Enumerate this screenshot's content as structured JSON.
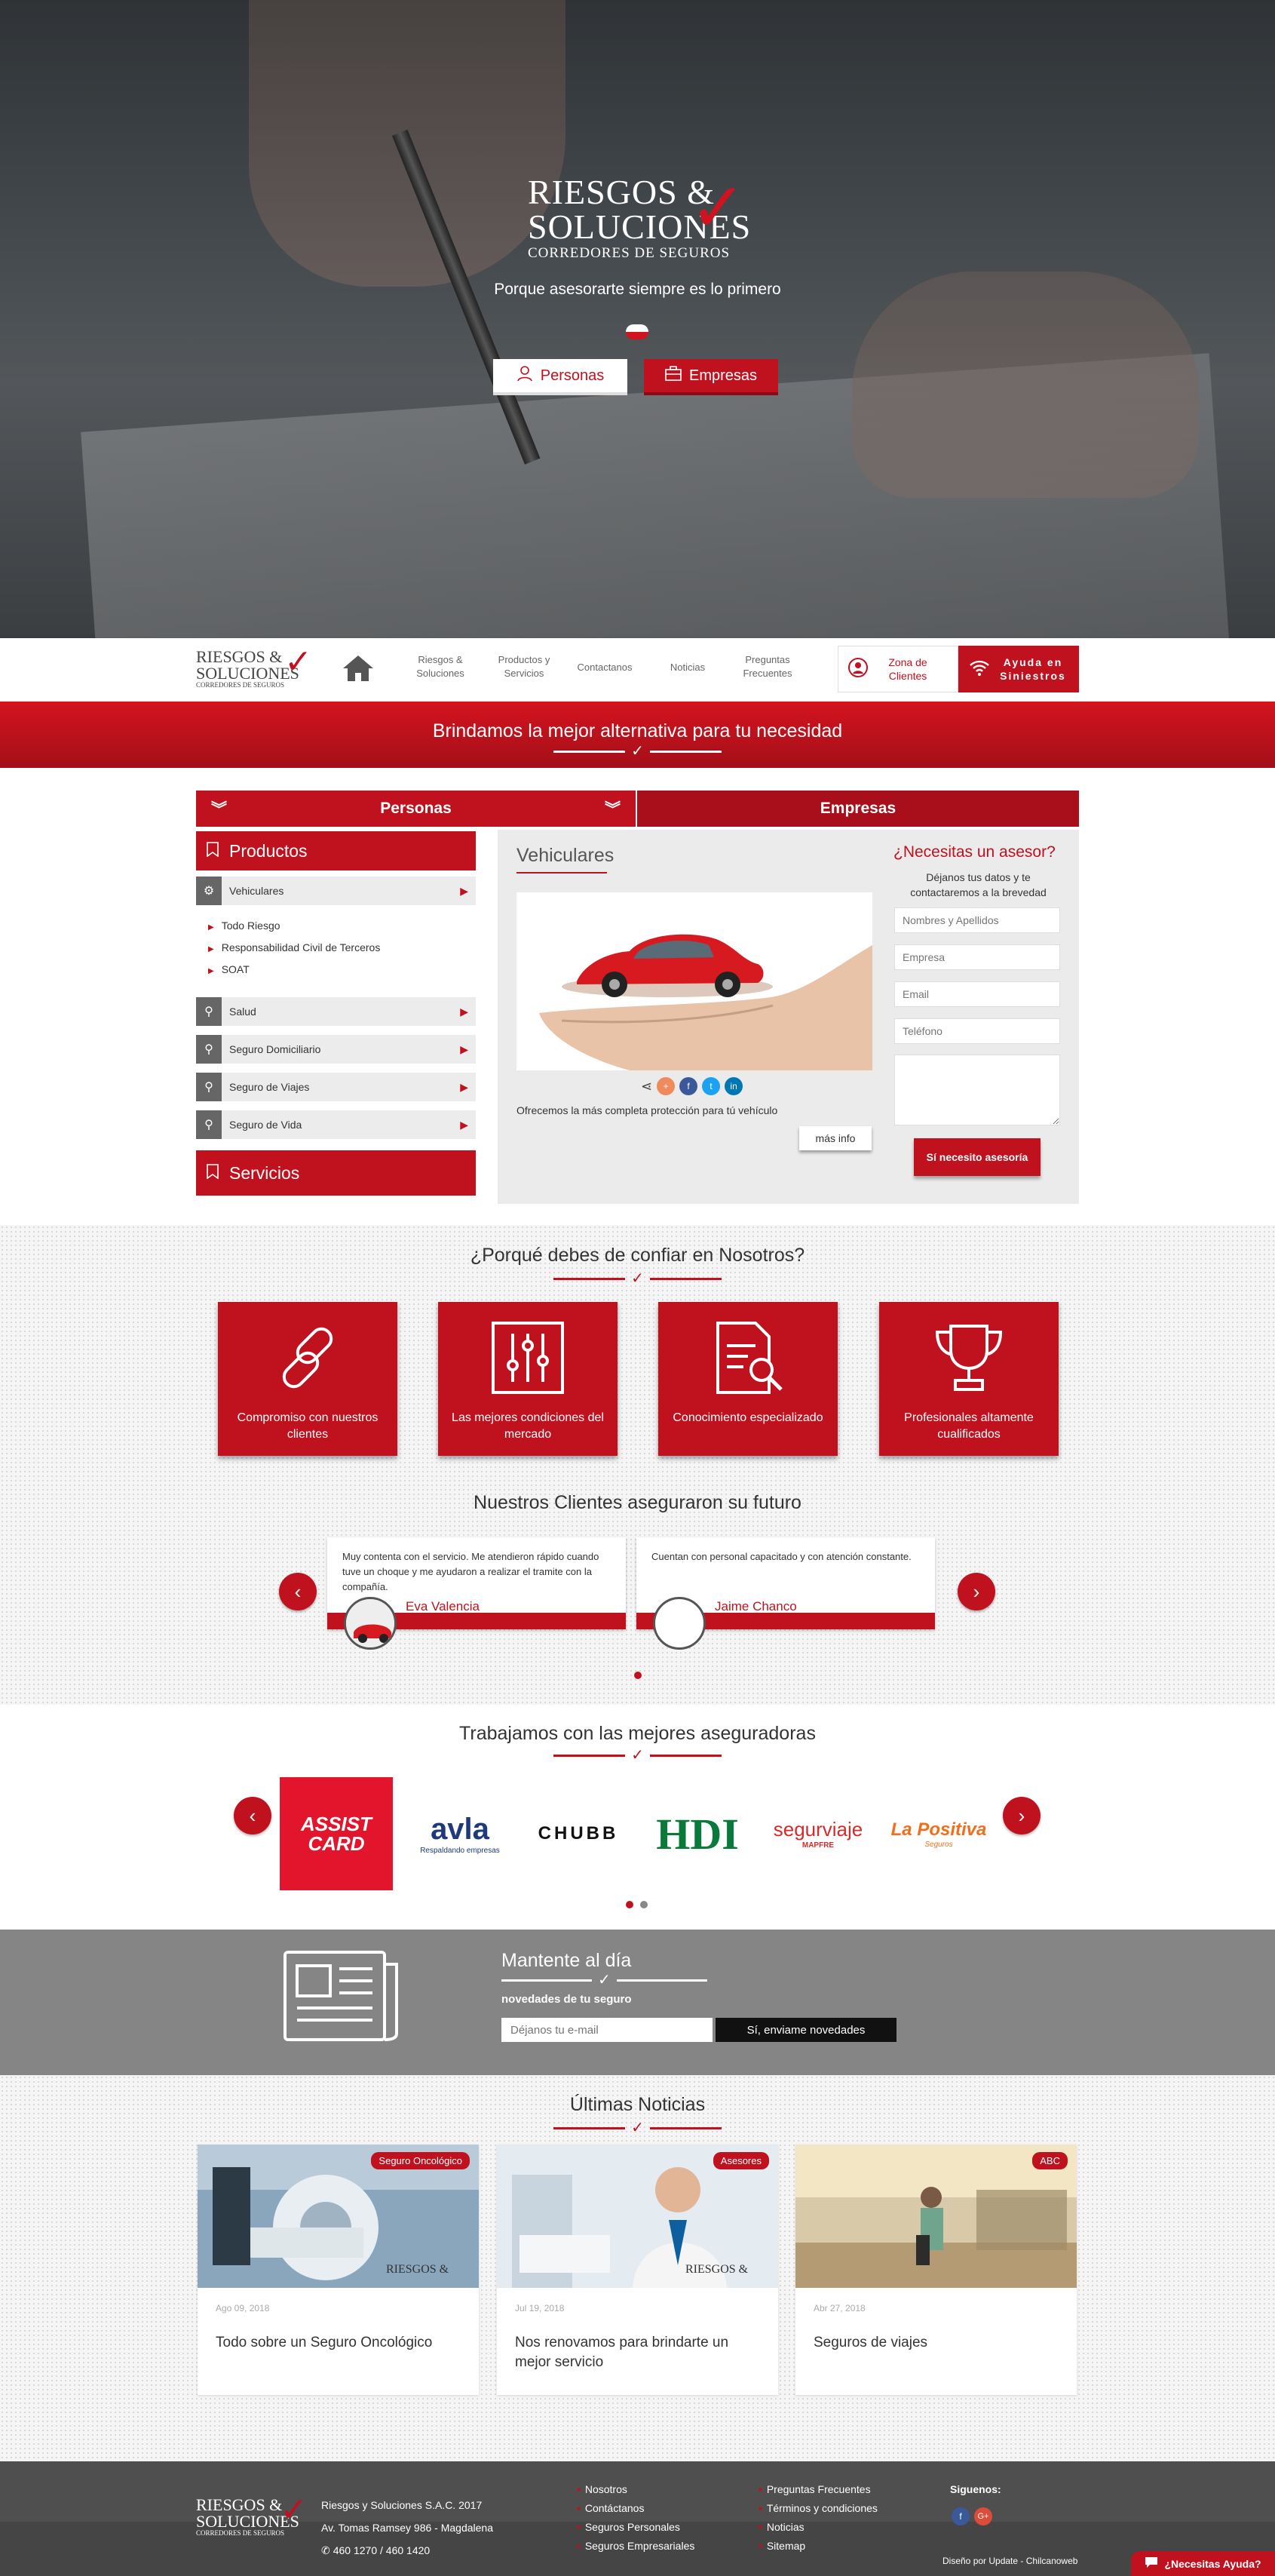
{
  "hero": {
    "logo": {
      "line1": "RIESGOS &",
      "line2": "SOLUCIONES",
      "line3": "CORREDORES DE SEGUROS"
    },
    "tagline": "Porque asesorarte siempre es lo primero",
    "btn_personas": "Personas",
    "btn_empresas": "Empresas"
  },
  "nav": {
    "logo": {
      "line1": "RIESGOS &",
      "line2": "SOLUCIONES",
      "line3": "CORREDORES DE SEGUROS"
    },
    "items": [
      {
        "label": "Riesgos & Soluciones"
      },
      {
        "label": "Productos y Servicios"
      },
      {
        "label": "Contactanos"
      },
      {
        "label": "Noticias"
      },
      {
        "label": "Preguntas Frecuentes"
      }
    ],
    "zona": "Zona de Clientes",
    "ayuda": "Ayuda en Siniestros"
  },
  "banner": {
    "text": "Brindamos la mejor alternativa para tu necesidad"
  },
  "tabs": {
    "personas": "Personas",
    "empresas": "Empresas"
  },
  "sidebar": {
    "productos": "Productos",
    "servicios": "Servicios",
    "items": [
      {
        "label": "Vehiculares"
      },
      {
        "label": "Salud"
      },
      {
        "label": "Seguro Domiciliario"
      },
      {
        "label": "Seguro de Viajes"
      },
      {
        "label": "Seguro de Vida"
      }
    ],
    "subitems": [
      "Todo Riesgo",
      "Responsabilidad Civil de Terceros",
      "SOAT"
    ]
  },
  "product": {
    "title": "Vehiculares",
    "description": "Ofrecemos la más completa protección para tú vehículo",
    "more": "más info"
  },
  "advisor": {
    "title": "¿Necesitas un asesor?",
    "subtitle": "Déjanos tus datos y te contactaremos a la brevedad",
    "name_ph": "Nombres y Apellidos",
    "company_ph": "Empresa",
    "email_ph": "Email",
    "phone_ph": "Teléfono",
    "button": "Sí necesito asesoría"
  },
  "why": {
    "title": "¿Porqué debes de confiar en Nosotros?",
    "cards": [
      {
        "label": "Compromiso con nuestros clientes",
        "icon": "chain-link-icon"
      },
      {
        "label": "Las mejores condiciones del mercado",
        "icon": "sliders-icon"
      },
      {
        "label": "Conocimiento especializado",
        "icon": "document-search-icon"
      },
      {
        "label": "Profesionales altamente cualificados",
        "icon": "trophy-icon"
      }
    ]
  },
  "testimonials": {
    "title": "Nuestros Clientes aseguraron su futuro",
    "items": [
      {
        "quote": "Muy contenta con el servicio. Me atendieron rápido cuando tuve un choque y me ayudaron a realizar el tramite con la compañía.",
        "name": "Eva Valencia"
      },
      {
        "quote": "Cuentan con personal capacitado y con atención constante.",
        "name": "Jaime Chanco"
      }
    ]
  },
  "insurers": {
    "title": "Trabajamos con las mejores aseguradoras",
    "logos": [
      {
        "name": "ASSIST CARD"
      },
      {
        "name": "avla",
        "sub": "Respaldando empresas"
      },
      {
        "name": "CHUBB"
      },
      {
        "name": "HDI"
      },
      {
        "name": "segurviaje",
        "sub": "MAPFRE"
      },
      {
        "name": "La Positiva",
        "sub": "Seguros"
      }
    ]
  },
  "newsletter": {
    "title": "Mantente al día",
    "subtitle": "novedades de tu seguro",
    "placeholder": "Déjanos tu e-mail",
    "button": "Sí, enviame novedades"
  },
  "news": {
    "title": "Últimas Noticias",
    "items": [
      {
        "tag": "Seguro Oncológico",
        "date": "Ago 09, 2018",
        "title": "Todo sobre un Seguro Oncológico"
      },
      {
        "tag": "Asesores",
        "date": "Jul 19, 2018",
        "title": "Nos renovamos para brindarte un mejor servicio"
      },
      {
        "tag": "ABC",
        "date": "Abr 27, 2018",
        "title": "Seguros de viajes"
      }
    ]
  },
  "footer": {
    "company": "Riesgos y Soluciones S.A.C. 2017",
    "address": "Av. Tomas Ramsey 986 - Magdalena",
    "phone": "460 1270 / 460 1420",
    "links1": [
      "Nosotros",
      "Contáctanos",
      "Seguros Personales",
      "Seguros Empresariales"
    ],
    "links2": [
      "Preguntas Frecuentes",
      "Términos y condiciones",
      "Noticias",
      "Sitemap"
    ],
    "follow": "Siguenos:",
    "credits": "Diseño por Update - Chilcanoweb",
    "chat": "¿Necesitas Ayuda?"
  },
  "colors": {
    "accent": "#c0111f",
    "gray": "#858585",
    "footer": "#4f4f4f"
  }
}
